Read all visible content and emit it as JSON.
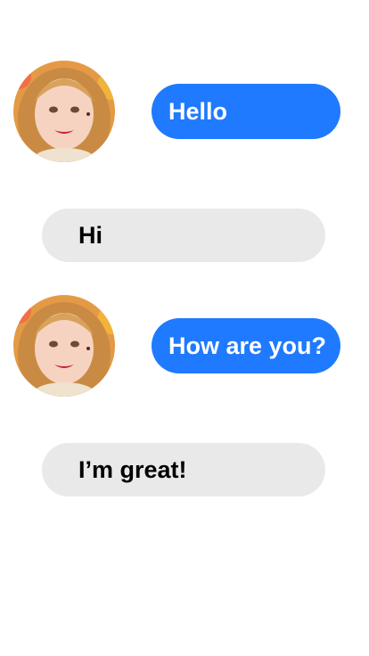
{
  "conversation": {
    "messages": [
      {
        "sender": "contact",
        "text": "Hello"
      },
      {
        "sender": "me",
        "text": "Hi"
      },
      {
        "sender": "contact",
        "text": "How are you?"
      },
      {
        "sender": "me",
        "text": "I’m great!"
      }
    ]
  },
  "colors": {
    "outgoing_bubble": "#1f7aff",
    "incoming_bubble": "#e9e9e9",
    "background": "#ffffff"
  }
}
